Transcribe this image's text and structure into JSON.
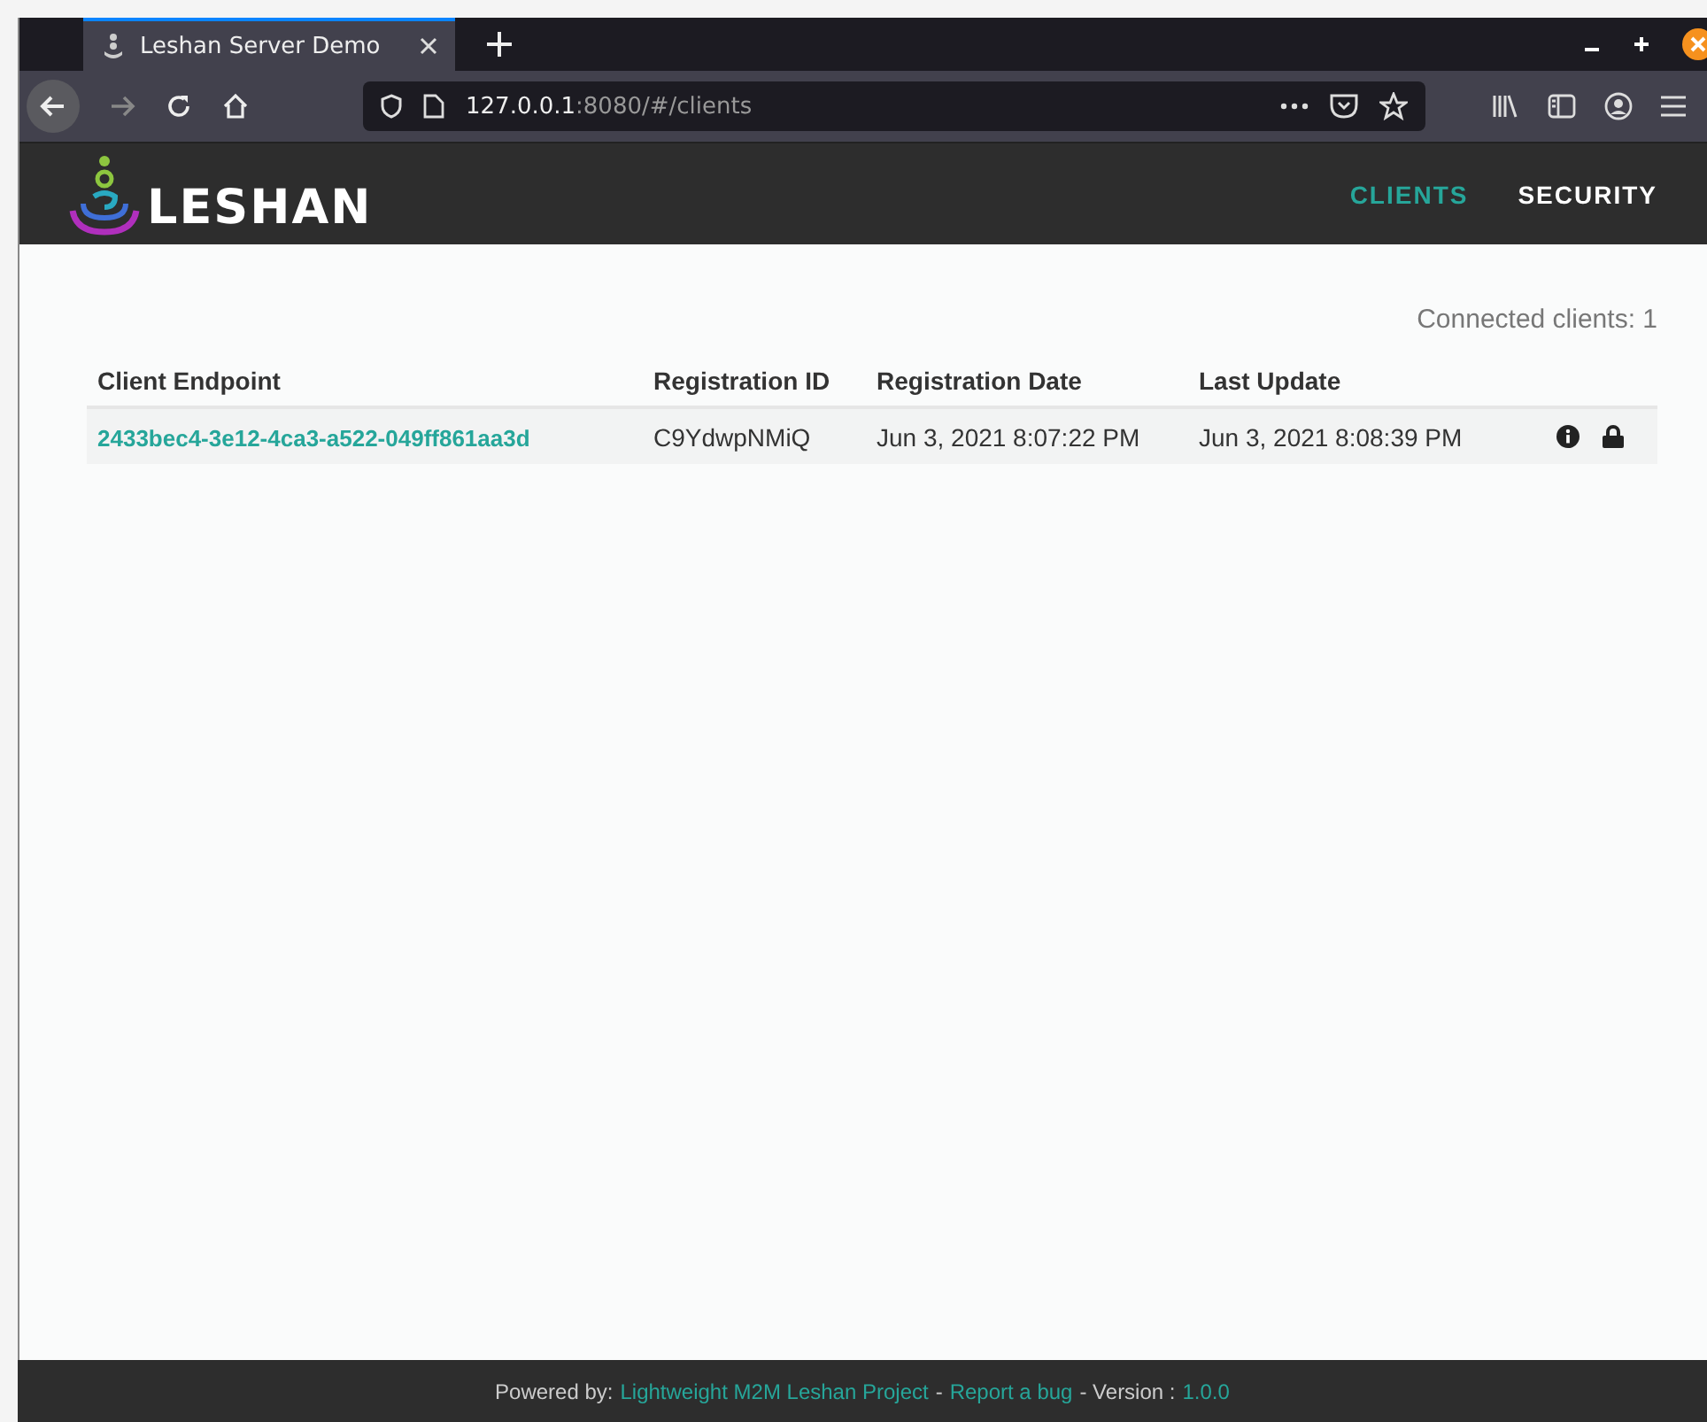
{
  "browser": {
    "tab_title": "Leshan Server Demo",
    "url_host": "127.0.0.1",
    "url_rest": ":8080/#/clients"
  },
  "header": {
    "logo_text": "LESHAN",
    "nav": [
      {
        "label": "CLIENTS",
        "selected": true
      },
      {
        "label": "SECURITY",
        "selected": false
      }
    ]
  },
  "connected": "Connected clients: 1",
  "table": {
    "columns": [
      "Client Endpoint",
      "Registration ID",
      "Registration Date",
      "Last Update"
    ],
    "rows": [
      {
        "endpoint": "2433bec4-3e12-4ca3-a522-049ff861aa3d",
        "registration_id": "C9YdwpNMiQ",
        "registration_date": "Jun 3, 2021 8:07:22 PM",
        "last_update": "Jun 3, 2021 8:08:39 PM",
        "secure": true
      }
    ]
  },
  "footer": [
    {
      "kind": "text",
      "text": "Powered by:"
    },
    {
      "kind": "link",
      "text": "Lightweight M2M Leshan Project"
    },
    {
      "kind": "text",
      "text": "-"
    },
    {
      "kind": "link",
      "text": "Report a bug"
    },
    {
      "kind": "text",
      "text": "- Version :"
    },
    {
      "kind": "link",
      "text": "1.0.0"
    }
  ]
}
